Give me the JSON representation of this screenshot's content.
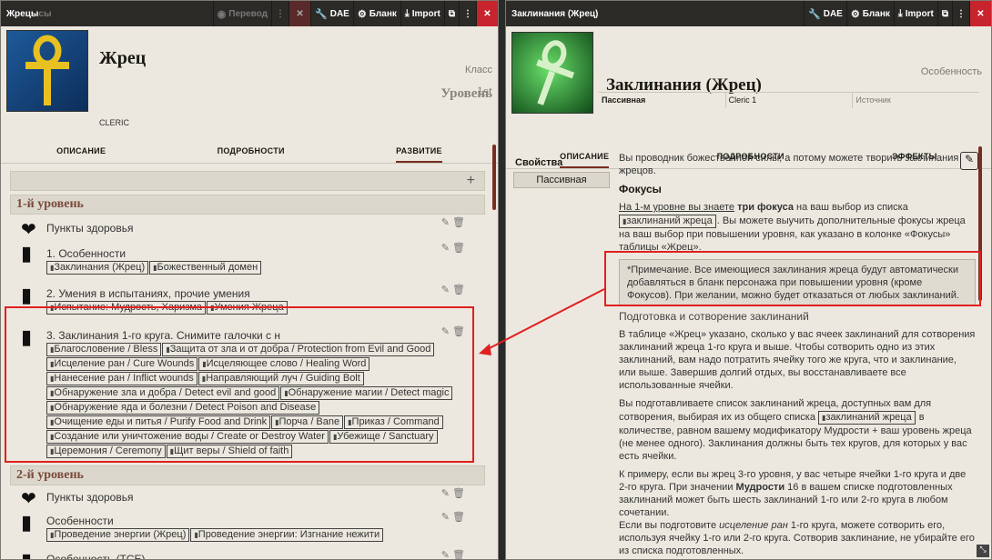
{
  "left": {
    "title": "Жрецы",
    "title_faded": "сы",
    "translate_label": "Перевод",
    "dae_label": "DAE",
    "blank_label": "Бланк",
    "import_label": "Import",
    "name": "Жрец",
    "identifier": "CLERIC",
    "class_label": "Класс",
    "level_label": "Уровень",
    "level_value": "1st",
    "tabs": [
      "ОПИСАНИЕ",
      "ПОДРОБНОСТИ",
      "РАЗВИТИЕ"
    ],
    "level1_heading": "1-й уровень",
    "level2_heading": "2-й уровень",
    "hp_label": "Пункты здоровья",
    "item1_title": "1. Особенности",
    "item1_chips": [
      "Заклинания (Жрец)",
      "Божественный домен"
    ],
    "item2_title": "2. Умения в испытаниях, прочие умения",
    "item2_chips": [
      "Испытание: Мудрость, Харизма",
      "Умения Жреца"
    ],
    "item3_title": "3. Заклинания 1-го круга. Снимите галочки с н",
    "item3_chips": [
      "Благословение / Bless",
      "Защита от зла и от добра / Protection from Evil and Good",
      "Исцеление ран / Cure Wounds",
      "Исцеляющее слово / Healing Word",
      "Нанесение ран / Inflict wounds",
      "Направляющий луч / Guiding Bolt",
      "Обнаружение зла и добра / Detect evil and good",
      "Обнаружение магии / Detect magic",
      "Обнаружение яда и болезни / Detect Poison and Disease",
      "Очищение еды и питья / Purify Food and Drink",
      "Порча / Bane",
      "Приказ / Command",
      "Создание или уничтожение воды / Create or Destroy Water",
      "Убежище / Sanctuary",
      "Церемония / Ceremony",
      "Щит веры / Shield of faith"
    ],
    "hp2_label": "Пункты здоровья",
    "item4_title": "Особенности",
    "item4_chips": [
      "Проведение энергии (Жрец)",
      "Проведение энергии: Изгнание нежити"
    ],
    "item5_title": "Особенность (TCE)"
  },
  "right": {
    "title": "Заклинания (Жрец)",
    "dae_label": "DAE",
    "blank_label": "Бланк",
    "import_label": "Import",
    "name": "Заклинания (Жрец)",
    "type_label": "Особенность",
    "row": [
      "Пассивная",
      "Cleric 1",
      "Источник"
    ],
    "tabs": [
      "ОПИСАНИЕ",
      "ПОДРОБНОСТИ",
      "ЭФФЕКТЫ"
    ],
    "props_label": "Свойства",
    "props_value": "Пассивная",
    "intro": "Вы проводник божественной силы, а потому можете творить заклинания жрецов.",
    "foci_heading": "Фокусы",
    "foci_text_a": "На 1-м уровне вы знаете",
    "foci_bold": "три фокуса",
    "foci_text_b": "на ваш выбор из списка",
    "foci_chip": "заклинаний жреца",
    "foci_text_c": ". Вы можете выучить дополнительные фокусы жреца на ваш выбор при повышении уровня, как указано в колонке «Фокусы» таблицы «Жрец».",
    "note": "*Примечание. Все имеющиеся заклинания жреца будут автоматически добавляться в бланк персонажа при повышении уровня (кроме Фокусов). При желании, можно будет отказаться от любых заклинаний.",
    "prep_heading": "Подготовка и сотворение заклинаний",
    "para1": "В таблице «Жрец» указано, сколько у вас ячеек заклинаний для сотворения заклинаний жреца 1-го круга и выше. Чтобы сотворить одно из этих заклинаний, вам надо потратить ячейку того же круга, что и заклинание, или выше. Завершив долгий отдых, вы восстанавливаете все использованные ячейки.",
    "para2_a": "Вы подготавливаете список заклинаний жреца, доступных вам для сотворения, выбирая их из общего списка",
    "para2_chip": "заклинаний жреца",
    "para2_b": "в количестве, равном вашему модификатору Мудрости + ваш уровень жреца (не менее одного). Заклинания должны быть тех кругов, для которых у вас есть ячейки.",
    "para3_a": "К примеру, если вы жрец 3-го уровня, у вас четыре ячейки 1-го круга и две 2-го круга. При значении",
    "para3_bold": "Мудрости",
    "para3_b": "16 в вашем списке подготовленных заклинаний может быть шесть заклинаний 1-го или 2-го круга в любом сочетании.",
    "para4_a": "Если вы подготовите",
    "para4_italic": "исцеление ран",
    "para4_b": "1-го круга, можете сотворить его, используя ячейку 1-го или 2-го круга. Сотворив заклинание, не убирайте его из списка подготовленных."
  }
}
